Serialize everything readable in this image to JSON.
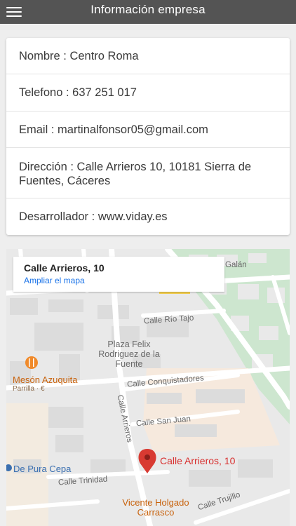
{
  "header": {
    "title": "Información empresa",
    "menu_icon": "menu-icon"
  },
  "info": {
    "rows": [
      {
        "label": "Nombre",
        "value": "Centro Roma"
      },
      {
        "label": "Telefono",
        "value": "637 251 017"
      },
      {
        "label": "Email",
        "value": "martinalfonsor05@gmail.com"
      },
      {
        "label": "Dirección",
        "value": "Calle Arrieros 10, 10181 Sierra de Fuentes, Cáceres"
      },
      {
        "label": "Desarrollador",
        "value": "www.viday.es"
      }
    ],
    "separator": " : "
  },
  "map": {
    "infobox": {
      "title": "Calle Arrieros, 10",
      "link": "Ampliar el mapa"
    },
    "pin_label": "Calle Arrieros, 10",
    "streets": {
      "rio_tajo": "Calle Río Tajo",
      "conquistadores": "Calle Conquistadores",
      "san_juan": "Calle San Juan",
      "arrieros": "Calle Arrieros",
      "trinidad": "Calle Trinidad",
      "trujillo": "Calle Trujillo",
      "galan": "Galán"
    },
    "places": {
      "plaza": "Plaza Felix Rodriguez de la Fuente",
      "meson": "Mesón Azuquita",
      "meson_sub": "Parrilla · €",
      "pura_cepa": "De Pura Cepa",
      "vicente": "Vicente Holgado Carrasco"
    },
    "colors": {
      "pin": "#d83a32",
      "park": "#cfe8cf",
      "highlight": "#f6e9dd",
      "road": "#ffffff"
    }
  }
}
